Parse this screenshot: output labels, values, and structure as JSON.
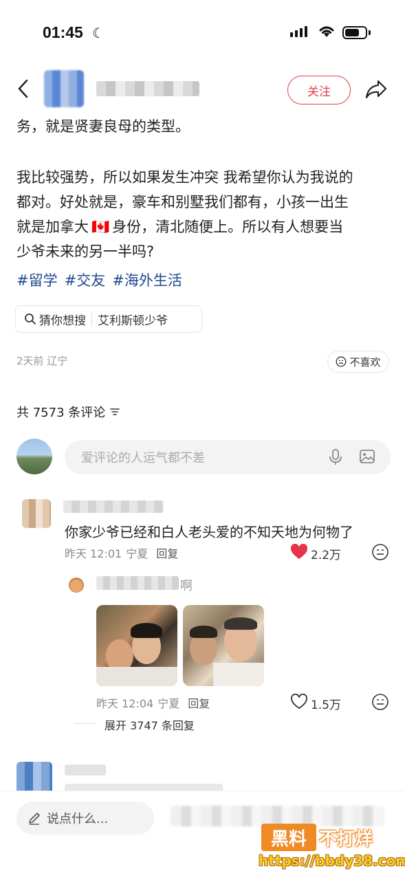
{
  "status_bar": {
    "time": "01:45"
  },
  "header": {
    "follow_label": "关注"
  },
  "post": {
    "lines": [
      "务，就是贤妻良母的类型。",
      "我比较强势，所以如果发生冲突 我希望你认为我说的",
      "都对。好处就是，豪车和别墅我们都有，小孩一出生",
      "就是加拿大",
      "身份，清北随便上。所以有人想要当",
      "少爷未来的另一半吗?"
    ],
    "flag_emoji": "🇨🇦",
    "tags": [
      "#留学",
      "#交友",
      "#海外生活"
    ],
    "search_suggest": {
      "label": "猜你想搜",
      "query": "艾利斯顿少爷"
    },
    "time_location": "2天前 辽宁",
    "dislike_label": "不喜欢"
  },
  "comments_header": {
    "count_text": "共 7573 条评论"
  },
  "comment_input": {
    "placeholder": "爱评论的人运气都不差"
  },
  "comments": [
    {
      "text": "你家少爷已经和白人老头爱的不知天地为何物了",
      "time": "昨天 12:01",
      "location": "宁夏",
      "reply_label": "回复",
      "likes": "2.2万",
      "liked": true
    }
  ],
  "reply": {
    "name_suffix": "啊",
    "time": "昨天 12:04",
    "location": "宁夏",
    "reply_label": "回复",
    "likes": "1.5万",
    "expand_text": "展开 3747 条回复"
  },
  "bottom_bar": {
    "say_placeholder": "说点什么..."
  },
  "watermark": {
    "brand_1": "黑料",
    "brand_2": "不打烊",
    "url": "https://bbdy38.com"
  },
  "colors": {
    "accent": "#e23c4a",
    "tag": "#1e4a8f",
    "like_red": "#e8334a",
    "watermark_orange": "#f08a24"
  }
}
